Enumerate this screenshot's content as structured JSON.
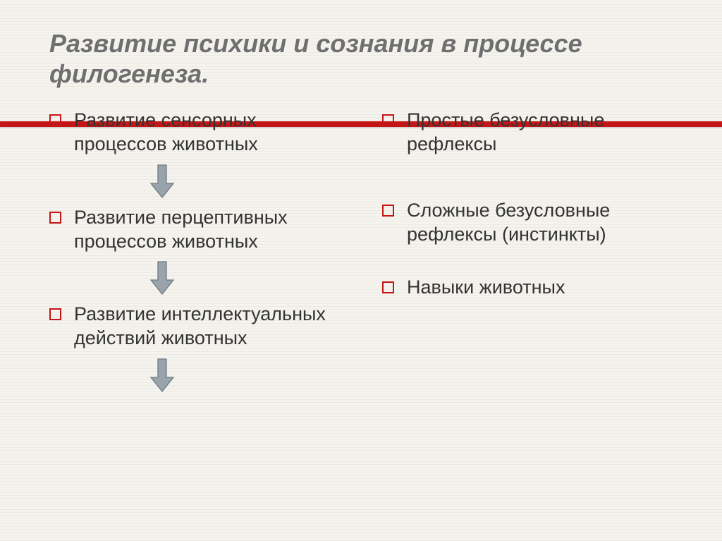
{
  "title": "Развитие психики и сознания в процессе филогенеза.",
  "left": {
    "items": [
      "Развитие сенсорных процессов животных",
      "Развитие перцептивных процессов животных",
      "Развитие интеллектуальных действий животных"
    ]
  },
  "right": {
    "items": [
      "Простые безусловные рефлексы",
      "Сложные безусловные рефлексы (инстинкты)",
      "Навыки животных"
    ]
  },
  "colors": {
    "accent": "#c41616",
    "arrowFill": "#99a3ab",
    "arrowStroke": "#6d7a84"
  }
}
